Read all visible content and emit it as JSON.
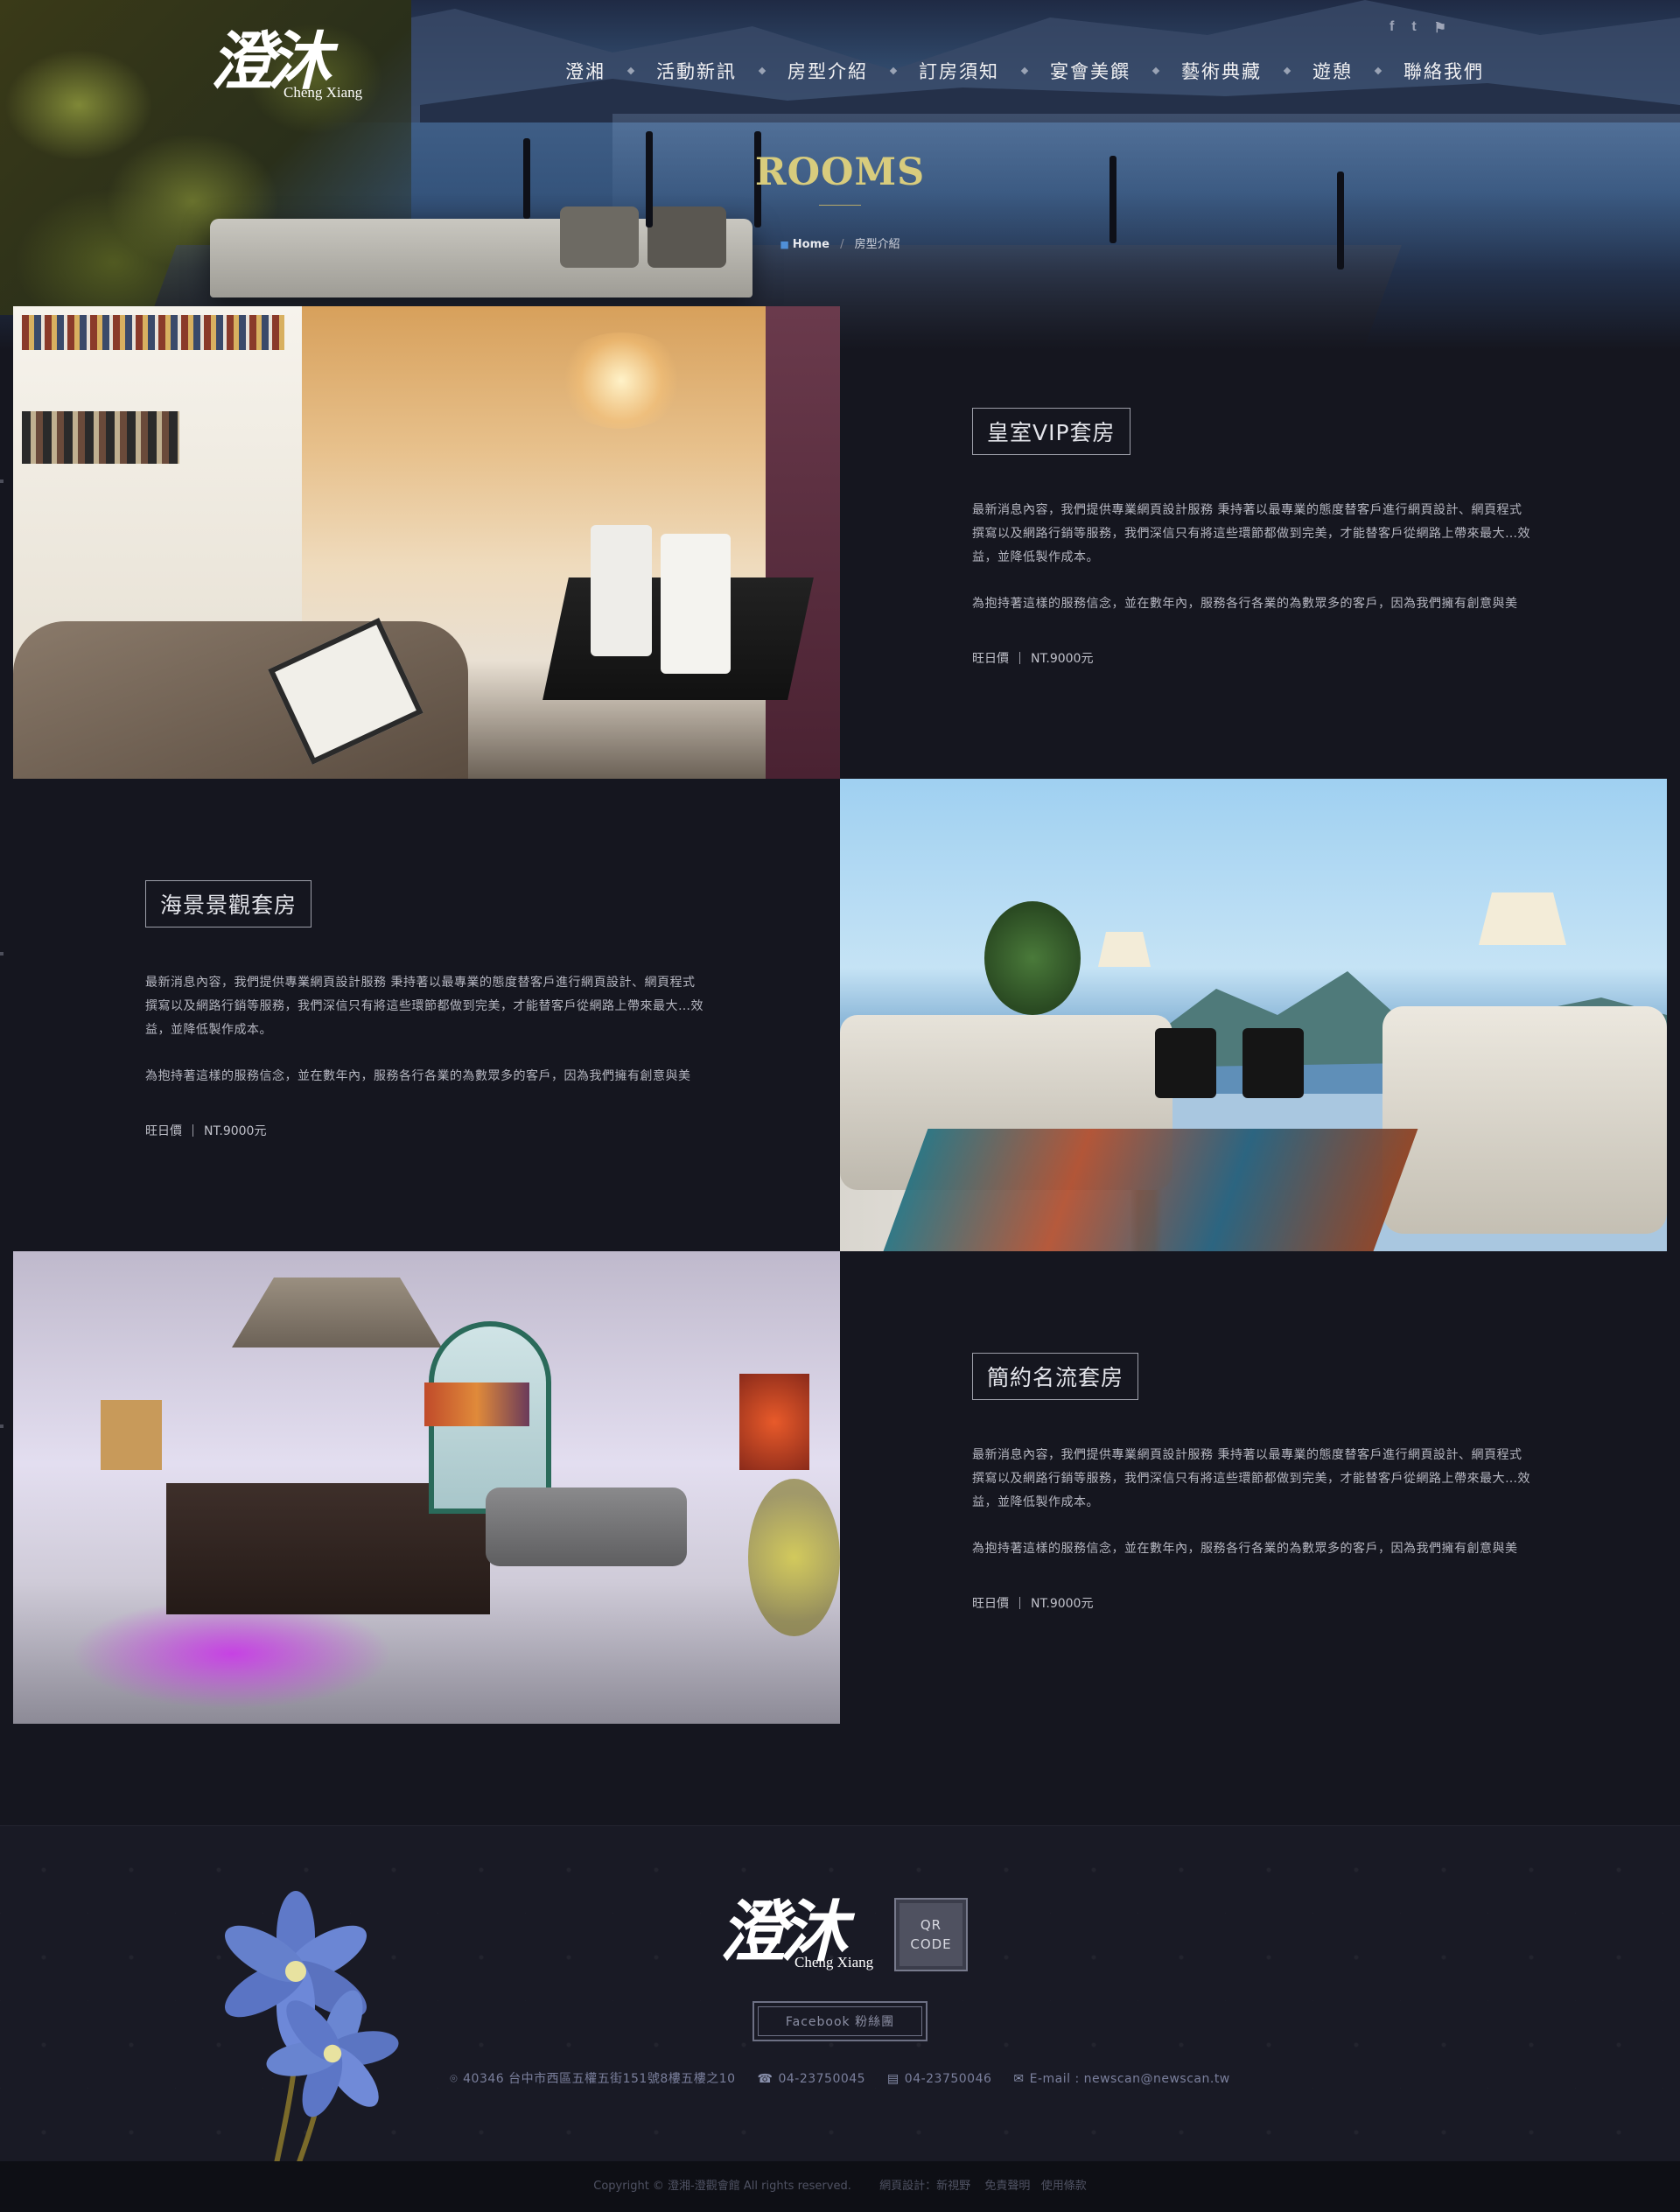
{
  "header": {
    "logo_text": "澄沐",
    "logo_sub": "Cheng Xiang",
    "social": [
      {
        "icon": "facebook-icon",
        "glyph": "f"
      },
      {
        "icon": "twitter-icon",
        "glyph": "t"
      },
      {
        "icon": "flag-icon",
        "glyph": "⚑"
      }
    ],
    "nav": [
      "澄湘",
      "活動新訊",
      "房型介紹",
      "訂房須知",
      "宴會美饌",
      "藝術典藏",
      "遊憩",
      "聯絡我們"
    ],
    "title": "ROOMS",
    "breadcrumb": {
      "home": "Home",
      "separator": "/",
      "current": "房型介紹"
    }
  },
  "rooms": [
    {
      "name": "皇室VIP套房",
      "desc": "最新消息內容，我們提供專業網頁設計服務 秉持著以最專業的態度替客戶進行網頁設計、網頁程式撰寫以及網路行銷等服務，我們深信只有將這些環節都做到完美，才能替客戶從網路上帶來最大…效益，並降低製作成本。",
      "desc2": "為抱持著這樣的服務信念，並在數年內，服務各行各業的為數眾多的客戶，因為我們擁有創意與美",
      "price_label": "旺日價",
      "price": "NT.9000元"
    },
    {
      "name": "海景景觀套房",
      "desc": "最新消息內容，我們提供專業網頁設計服務 秉持著以最專業的態度替客戶進行網頁設計、網頁程式撰寫以及網路行銷等服務，我們深信只有將這些環節都做到完美，才能替客戶從網路上帶來最大…效益，並降低製作成本。",
      "desc2": "為抱持著這樣的服務信念，並在數年內，服務各行各業的為數眾多的客戶，因為我們擁有創意與美",
      "price_label": "旺日價",
      "price": "NT.9000元"
    },
    {
      "name": "簡約名流套房",
      "desc": "最新消息內容，我們提供專業網頁設計服務 秉持著以最專業的態度替客戶進行網頁設計、網頁程式撰寫以及網路行銷等服務，我們深信只有將這些環節都做到完美，才能替客戶從網路上帶來最大…效益，並降低製作成本。",
      "desc2": "為抱持著這樣的服務信念，並在數年內，服務各行各業的為數眾多的客戶，因為我們擁有創意與美",
      "price_label": "旺日價",
      "price": "NT.9000元"
    }
  ],
  "footer": {
    "logo_text": "澄沐",
    "logo_sub": "Cheng Xiang",
    "qr_line1": "QR",
    "qr_line2": "CODE",
    "facebook_button": "Facebook 粉絲團",
    "address": "40346 台中市西區五權五街151號8樓五樓之10",
    "phone": "04-23750045",
    "fax": "04-23750046",
    "email": "E-mail : newscan@newscan.tw",
    "copyright": "Copyright © 澄湘-澄觀會館 All rights reserved.",
    "design_credit": "網頁設計：新視野",
    "disclaimer": "免責聲明",
    "terms": "使用條款"
  },
  "colors": {
    "background": "#15161f",
    "title_gold": "#d8cc7d",
    "footer_text": "#7a7f9c"
  }
}
